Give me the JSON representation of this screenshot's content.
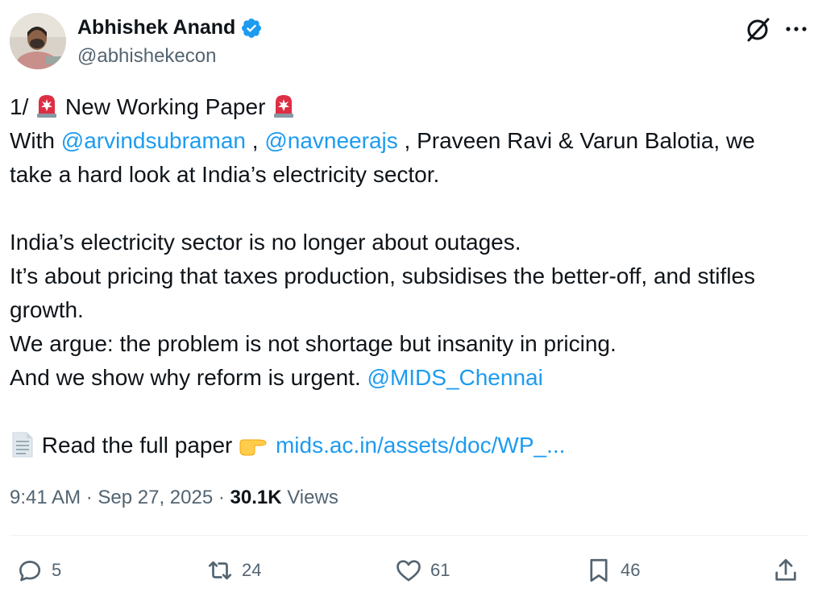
{
  "author": {
    "name": "Abhishek Anand",
    "handle": "@abhishekecon",
    "verified": true
  },
  "tweet": {
    "line1": {
      "prefix": "1/ ",
      "text": " New Working Paper "
    },
    "line2": {
      "with": "With ",
      "mention1": "@arvindsubraman",
      "sep1": " , ",
      "mention2": "@navneerajs",
      "rest": " , Praveen Ravi & Varun Balotia, we"
    },
    "line3": "take a hard look at India’s electricity sector.",
    "line4": "India’s electricity sector is no longer about outages.",
    "line5": "It’s about pricing that taxes production, subsidises the better-off, and stifles",
    "line6": "growth.",
    "line7": "We argue: the problem is not shortage but insanity in pricing.",
    "line8": {
      "text": "And we show why reform is urgent. ",
      "mention": "@MIDS_Chennai"
    },
    "line9": {
      "text": " Read the full paper ",
      "link": "mids.ac.in/assets/doc/WP_..."
    }
  },
  "meta": {
    "time": "9:41 AM",
    "sep": " · ",
    "date": "Sep 27, 2025",
    "views_count": "30.1K",
    "views_label": " Views"
  },
  "actions": {
    "replies": "5",
    "reposts": "24",
    "likes": "61",
    "bookmarks": "46"
  },
  "icons": {
    "header_right": [
      "grok-icon",
      "more-icon"
    ],
    "actions": [
      "reply-icon",
      "repost-icon",
      "like-icon",
      "bookmark-icon",
      "share-icon"
    ]
  },
  "colors": {
    "link": "#1d9bf0",
    "secondary": "#536471",
    "text": "#0f1419",
    "verified": "#1d9bf0"
  }
}
